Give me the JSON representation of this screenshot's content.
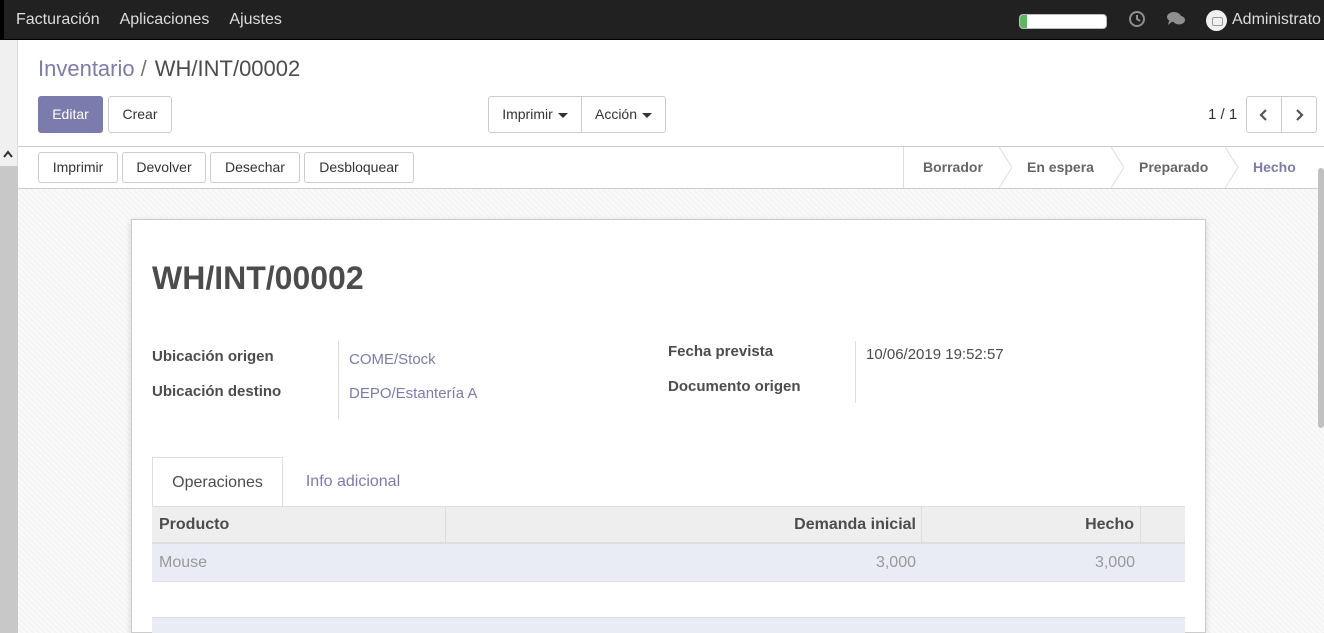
{
  "navbar": {
    "menu": [
      "Facturación",
      "Aplicaciones",
      "Ajustes"
    ],
    "progress_percent": 8,
    "icons": [
      "clock-icon",
      "chat-icon"
    ],
    "user": "Administrato"
  },
  "breadcrumb": {
    "parent": "Inventario",
    "separator": "/",
    "current": "WH/INT/00002"
  },
  "buttons": {
    "edit": "Editar",
    "create": "Crear",
    "print": "Imprimir",
    "action": "Acción"
  },
  "pager": {
    "value": "1 / 1"
  },
  "statusbar": {
    "actions": [
      "Imprimir",
      "Devolver",
      "Desechar",
      "Desbloquear"
    ],
    "stages": [
      "Borrador",
      "En espera",
      "Preparado",
      "Hecho"
    ],
    "active_stage": "Hecho"
  },
  "record": {
    "name": "WH/INT/00002",
    "source_location_label": "Ubicación origen",
    "source_location": "COME/Stock",
    "dest_location_label": "Ubicación destino",
    "dest_location": "DEPO/Estantería A",
    "scheduled_date_label": "Fecha prevista",
    "scheduled_date": "10/06/2019 19:52:57",
    "origin_label": "Documento origen",
    "origin": ""
  },
  "tabs": [
    "Operaciones",
    "Info adicional"
  ],
  "operations": {
    "columns": [
      "Producto",
      "Demanda inicial",
      "Hecho"
    ],
    "rows": [
      {
        "product": "Mouse",
        "demand": "3,000",
        "done": "3,000"
      }
    ]
  },
  "colors": {
    "accent": "#7c7bad",
    "navbar": "#212121",
    "progress": "#5cb85c"
  }
}
